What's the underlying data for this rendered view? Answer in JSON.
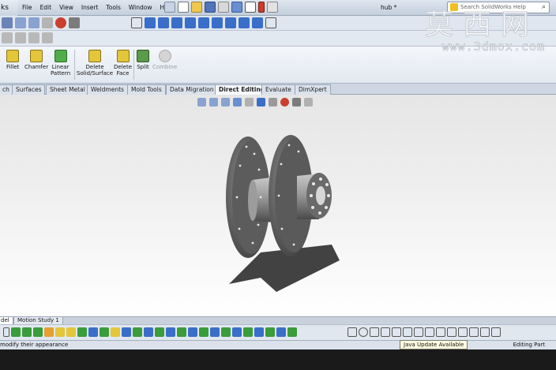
{
  "app": {
    "name": "ks",
    "document_title": "hub *"
  },
  "menu": [
    "File",
    "Edit",
    "View",
    "Insert",
    "Tools",
    "Window",
    "Help"
  ],
  "search": {
    "placeholder": "Search SolidWorks Help"
  },
  "watermark": {
    "chinese": "莫西网",
    "url": "www.3dmox.com"
  },
  "command_manager": {
    "fillet": "Fillet",
    "chamfer": "Chamfer",
    "linear_pattern": [
      "Linear",
      "Pattern"
    ],
    "delete_solid": [
      "Delete",
      "Solid/Surface"
    ],
    "delete_face": [
      "Delete",
      "Face"
    ],
    "split": "Split",
    "combine": "Combine"
  },
  "tabs": [
    {
      "label": "ch",
      "active": false
    },
    {
      "label": "Surfaces",
      "active": false
    },
    {
      "label": "Sheet Metal",
      "active": false
    },
    {
      "label": "Weldments",
      "active": false
    },
    {
      "label": "Mold Tools",
      "active": false
    },
    {
      "label": "Data Migration",
      "active": false
    },
    {
      "label": "Direct Editing",
      "active": true
    },
    {
      "label": "Evaluate",
      "active": false
    },
    {
      "label": "DimXpert",
      "active": false
    }
  ],
  "bottom_tabs": [
    {
      "label": "del",
      "active": true
    },
    {
      "label": "Motion Study 1",
      "active": false
    }
  ],
  "status": {
    "message": "modify their appearance",
    "notification": "Java Update Available",
    "mode": "Editing Part"
  },
  "colors": {
    "part_gray": "#5d5d5d",
    "accent_blue": "#3a6ec8",
    "ui_chrome": "#dfe6ef"
  }
}
